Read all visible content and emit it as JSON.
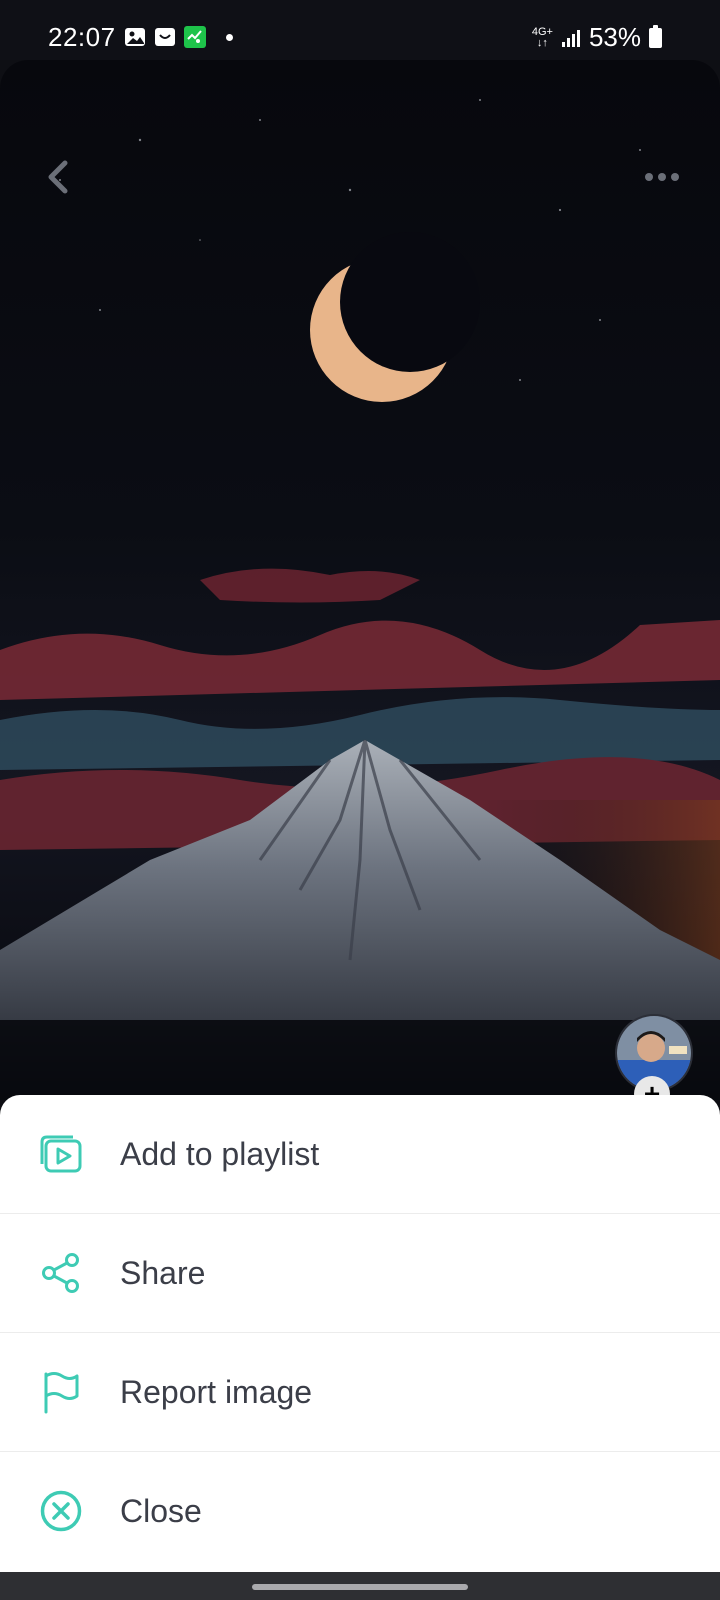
{
  "status_bar": {
    "time": "22:07",
    "network": "4G+",
    "battery": "53%",
    "notification_icons": [
      "gallery-icon",
      "shop-icon",
      "activity-icon"
    ]
  },
  "viewer": {
    "icons": {
      "back": "chevron-left-icon",
      "more": "more-horizontal-icon"
    },
    "avatar_badge": "+"
  },
  "sheet": {
    "accent_color": "#3ecbb4",
    "items": [
      {
        "label": "Add to playlist",
        "icon": "playlist-add-icon"
      },
      {
        "label": "Share",
        "icon": "share-icon"
      },
      {
        "label": "Report image",
        "icon": "flag-icon"
      },
      {
        "label": "Close",
        "icon": "close-circle-icon"
      }
    ]
  }
}
